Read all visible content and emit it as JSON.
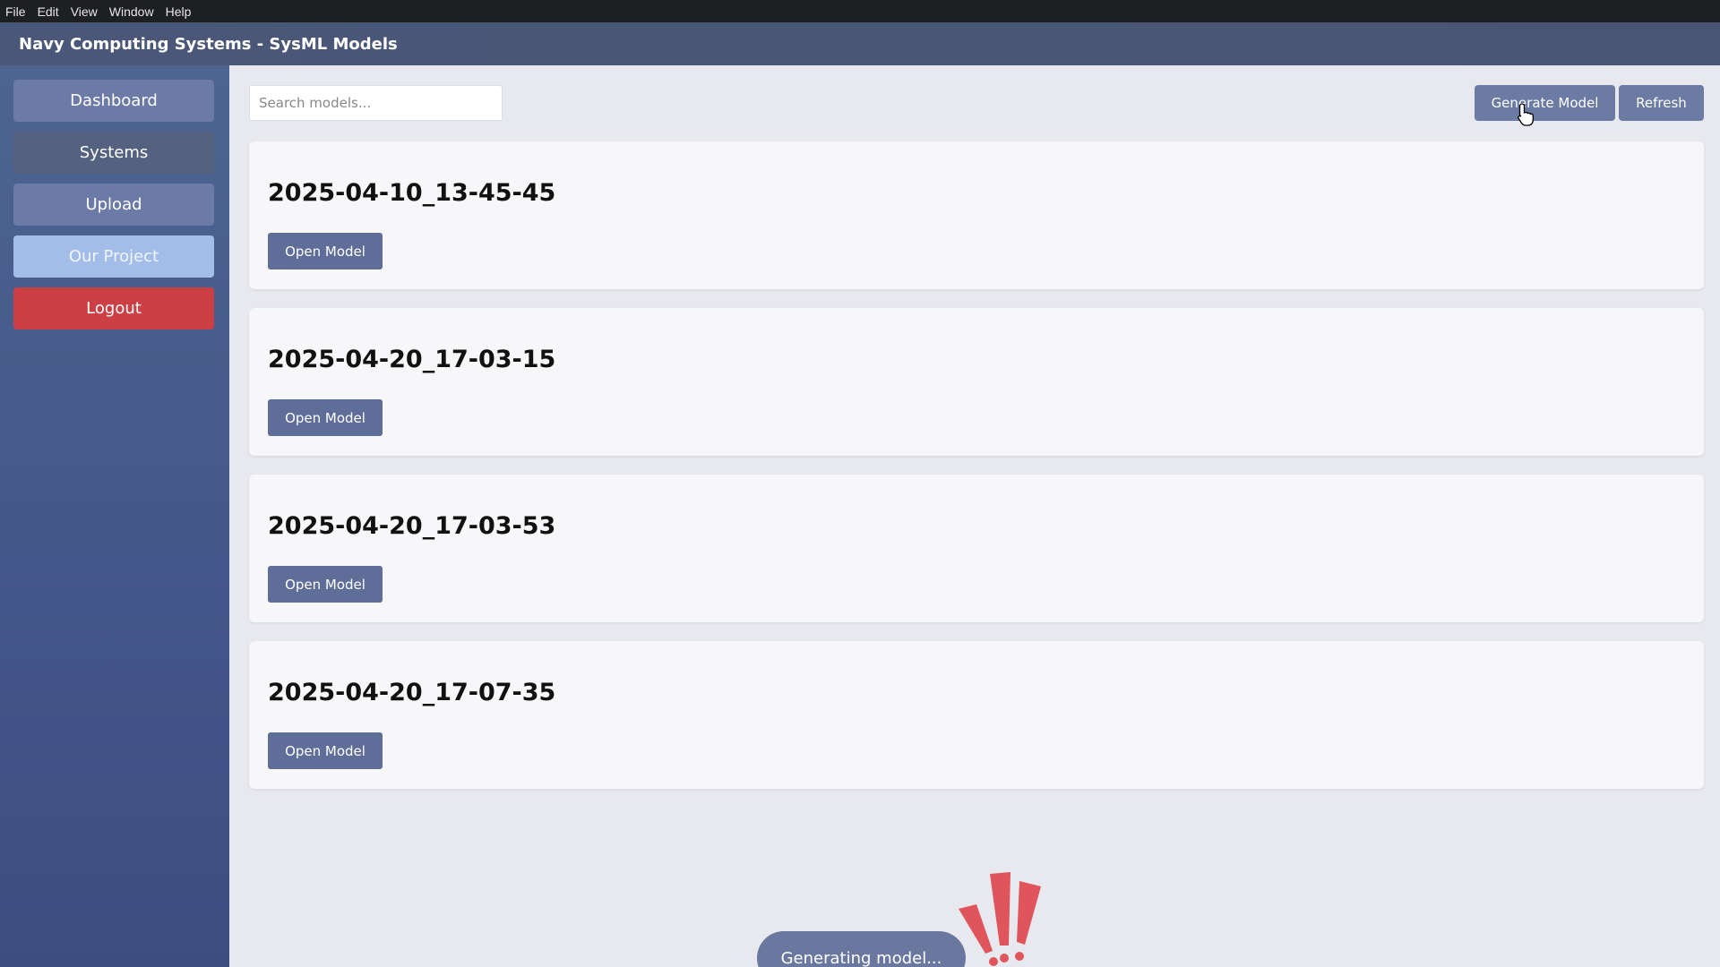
{
  "menubar": {
    "items": [
      "File",
      "Edit",
      "View",
      "Window",
      "Help"
    ]
  },
  "app": {
    "title": "Navy Computing Systems - SysML Models"
  },
  "sidebar": {
    "items": [
      {
        "label": "Dashboard"
      },
      {
        "label": "Systems"
      },
      {
        "label": "Upload"
      },
      {
        "label": "Our Project"
      },
      {
        "label": "Logout"
      }
    ]
  },
  "search": {
    "placeholder": "Search models..."
  },
  "toolbar": {
    "generate_label": "Generate Model",
    "refresh_label": "Refresh"
  },
  "models": [
    {
      "name": "2025-04-10_13-45-45",
      "action": "Open Model"
    },
    {
      "name": "2025-04-20_17-03-15",
      "action": "Open Model"
    },
    {
      "name": "2025-04-20_17-03-53",
      "action": "Open Model"
    },
    {
      "name": "2025-04-20_17-07-35",
      "action": "Open Model"
    }
  ],
  "status": {
    "toast": "Generating model..."
  },
  "colors": {
    "accent": "#6c7ba3",
    "logout": "#cc3f45",
    "active_nav": "#a3bde9",
    "exclaim": "#e0444b"
  },
  "icons": {
    "cursor": "hand-pointer-icon",
    "alert": "exclamation-burst-icon"
  }
}
